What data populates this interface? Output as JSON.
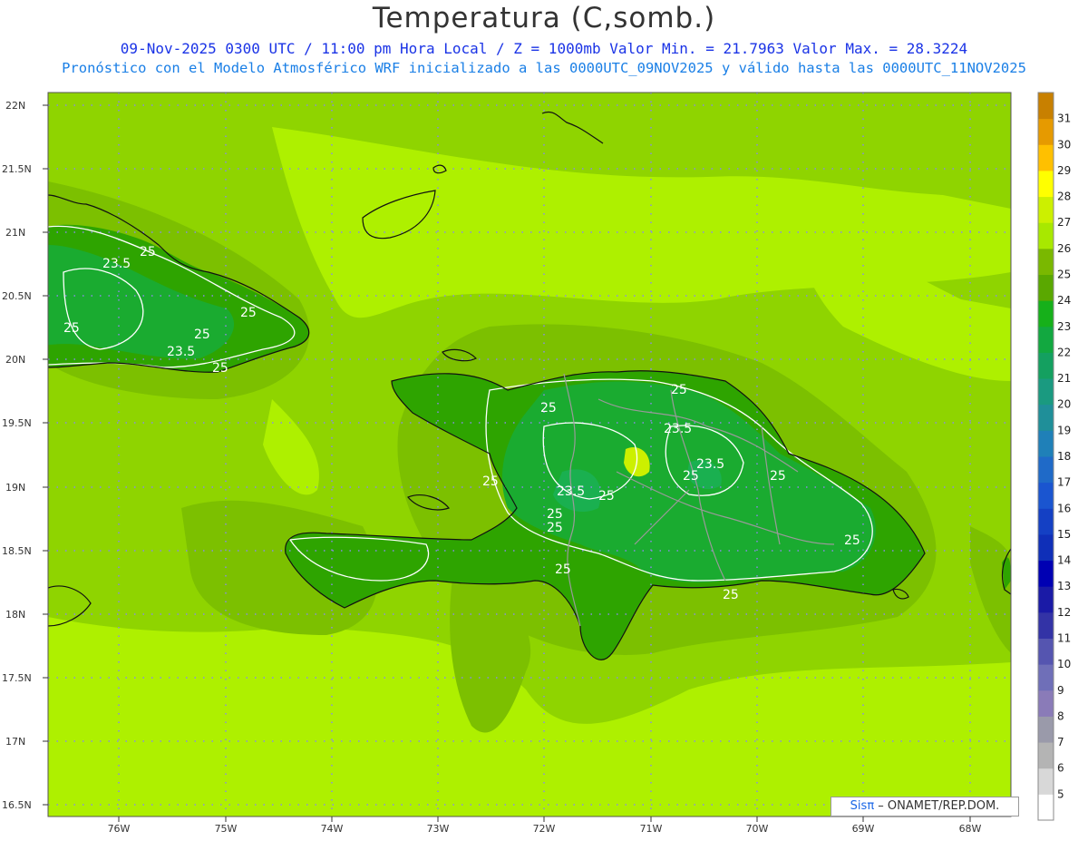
{
  "header": {
    "title": "Temperatura (C,somb.)",
    "line1": "09-Nov-2025 0300 UTC / 11:00 pm Hora Local / Z = 1000mb  Valor Min. = 21.7963  Valor Max. = 28.3224",
    "line2": "Pronóstico con el Modelo Atmosférico WRF inicializado a las 0000UTC_09NOV2025 y válido hasta las  0000UTC_11NOV2025"
  },
  "axes": {
    "lat_labels": [
      "22N",
      "21.5N",
      "21N",
      "20.5N",
      "20N",
      "19.5N",
      "19N",
      "18.5N",
      "18N",
      "17.5N",
      "17N",
      "16.5N"
    ],
    "lon_labels": [
      "76W",
      "75W",
      "74W",
      "73W",
      "72W",
      "71W",
      "70W",
      "69W",
      "68W"
    ]
  },
  "colorbar": {
    "labels": [
      "5",
      "6",
      "7",
      "8",
      "9",
      "10",
      "11",
      "12",
      "13",
      "14",
      "15",
      "16",
      "17",
      "18",
      "19",
      "20",
      "21",
      "22",
      "23",
      "24",
      "25",
      "26",
      "27",
      "28",
      "29",
      "30",
      "31"
    ],
    "colors": [
      "#ffffff",
      "#d8d8d8",
      "#b4b4b4",
      "#9a9aaa",
      "#8a7bb8",
      "#6f6fb8",
      "#5555b0",
      "#3333a6",
      "#1a1aa6",
      "#0000b3",
      "#0f2fb8",
      "#1440c4",
      "#1a55d0",
      "#1f6ac8",
      "#1f80b8",
      "#1f8f99",
      "#1a9a80",
      "#14a060",
      "#12a840",
      "#16b01a",
      "#5aa800",
      "#7ab800",
      "#a8e800",
      "#ccf000",
      "#ffff00",
      "#ffc000",
      "#e69a00",
      "#c88000"
    ]
  },
  "contour_labels": [
    "25",
    "23.5",
    "25",
    "25",
    "23.5",
    "25",
    "25",
    "25",
    "23.5",
    "23.5",
    "25",
    "25",
    "25",
    "23.5",
    "25",
    "25",
    "25",
    "25",
    "25",
    "25"
  ],
  "credit": {
    "logo": "Sis",
    "pi": "π",
    "text": "– ONAMET/REP.DOM."
  }
}
